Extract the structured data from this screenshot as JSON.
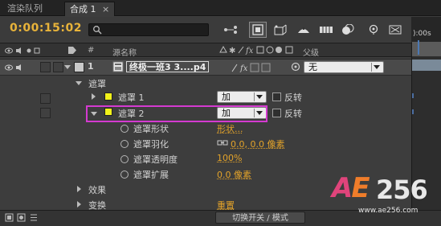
{
  "tabs": [
    {
      "label": "渲染队列",
      "active": false
    },
    {
      "label": "合成 1",
      "active": true
    }
  ],
  "tab_close_glyph": "×",
  "timecode": "0:00:15:02",
  "search": {
    "placeholder": ""
  },
  "ruler": {
    "label": "):00s"
  },
  "columns": {
    "hash": "#",
    "source_name": "源名称",
    "parent": "父级"
  },
  "layer": {
    "index": "1",
    "name": "终极一班3 3....p4",
    "parent_value": "无"
  },
  "masks_group": {
    "label": "遮罩"
  },
  "masks": [
    {
      "label": "遮罩 1",
      "mode": "加",
      "inverted_label": "反转",
      "expanded": false
    },
    {
      "label": "遮罩 2",
      "mode": "加",
      "inverted_label": "反转",
      "expanded": true
    }
  ],
  "mask_props": [
    {
      "label": "遮罩形状",
      "value": "形状..."
    },
    {
      "label": "遮罩羽化",
      "value": "0.0, 0.0 像素"
    },
    {
      "label": "遮罩透明度",
      "value": "100%"
    },
    {
      "label": "遮罩扩展",
      "value": "0.0 像素"
    }
  ],
  "groups": [
    {
      "label": "效果",
      "value": ""
    },
    {
      "label": "变换",
      "value": "重置"
    }
  ],
  "bottom": {
    "toggle_label": "切换开关 / 模式"
  },
  "watermark": {
    "logo_a": "A",
    "logo_e": "E",
    "logo_num": "256",
    "url": "www.ae256.com"
  },
  "colors": {
    "accent_orange": "#e3a32a",
    "highlight_magenta": "#d43ad0",
    "mask_yellow": "#f2f21a"
  }
}
